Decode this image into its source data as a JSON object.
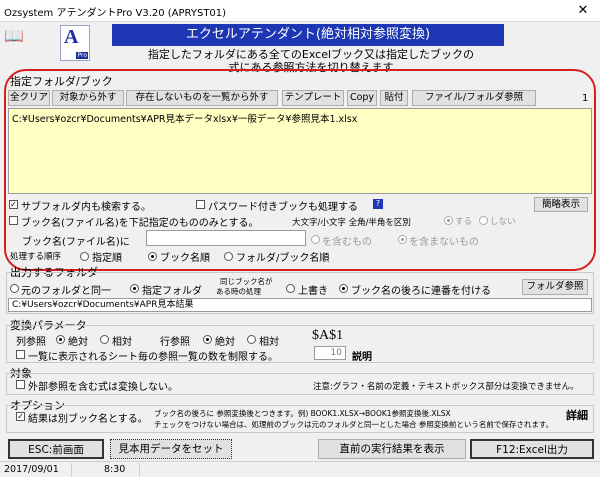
{
  "window": {
    "title": "Ozsystem アテンダントPro V3.20 (APRYST01)",
    "close_glyph": "✕"
  },
  "logo": {
    "letter": "A",
    "sub": "Pro"
  },
  "header": {
    "banner": "エクセルアテンダント(絶対相対参照変換)",
    "desc_line1": "指定したフォルダにある全てのExcelブック又は指定したブックの",
    "desc_line2": "式にある参照方法を切り替えます"
  },
  "target_folder": {
    "label": "指定フォルダ/ブック",
    "count": "1",
    "buttons": {
      "clear_all": "全クリア",
      "remove": "対象から外す",
      "remove_missing": "存在しないものを一覧から外す",
      "template": "テンプレート",
      "copy": "Copy",
      "paste": "貼付",
      "browse": "ファイル/フォルダ参照"
    },
    "path_list": "C:¥Users¥ozcr¥Documents¥APR見本データxlsx¥一般データ¥参照見本1.xlsx",
    "include_subfolders": "サブフォルダ内も検索する。",
    "include_password": "パスワード付きブックも処理する",
    "simple_display_button": "簡略表示",
    "filter_by_name": "ブック名(ファイル名)を下記指定のもののみとする。",
    "case_sensitivity_label": "大文字/小文字 全角/半角を区別",
    "case_yes": "する",
    "case_no": "しない",
    "book_name_label": "ブック名(ファイル名)に",
    "contains": "を含むもの",
    "not_contains": "を含まないもの",
    "order_label": "処理する順序",
    "order_specified": "指定順",
    "order_book": "ブック名順",
    "order_folder_book": "フォルダ/ブック名順"
  },
  "output_folder": {
    "label": "出力するフォルダ",
    "same_folder": "元のフォルダと同一",
    "specified_folder": "指定フォルダ",
    "same_name_line1": "同じブック名が",
    "same_name_line2": "ある時の処理",
    "overwrite": "上書き",
    "append_number": "ブック名の後ろに連番を付ける",
    "browse": "フォルダ参照",
    "path": "C:¥Users¥ozcr¥Documents¥APR見本結果"
  },
  "conversion": {
    "label": "変換パラメータ",
    "column_ref": "列参照",
    "row_ref": "行参照",
    "absolute": "絶対",
    "relative": "相対",
    "example": "$A$1",
    "limit_label": "一覧に表示されるシート毎の参照一覧の数を制限する。",
    "limit_value": "10",
    "explain": "説明"
  },
  "target": {
    "label": "対象",
    "external_ref": "外部参照を含む式は変換しない。",
    "note": "注意:グラフ・名前の定義・テキストボックス部分は変換できません。"
  },
  "options": {
    "label": "オプション",
    "save_as": "結果は別ブック名とする。",
    "note1": "ブック名の後ろに 参照変換後とつきます。例) BOOK1.XLSX→BOOK1参照変換後.XLSX",
    "note2": "チェックをつけない場合は、処理前のブックは元のフォルダと同一とした場合 参照変換前という名前で保存されます。",
    "detail": "詳細"
  },
  "bottom_buttons": {
    "esc": "ESC:前画面",
    "sample": "見本用データをセット",
    "last_result": "直前の実行結果を表示",
    "f12": "F12:Excel出力"
  },
  "status": {
    "date": "2017/09/01",
    "time": "8:30"
  },
  "colors": {
    "banner": "#1c36b4",
    "highlight_oval": "#d42020",
    "path_bg": "#ffffc4"
  }
}
